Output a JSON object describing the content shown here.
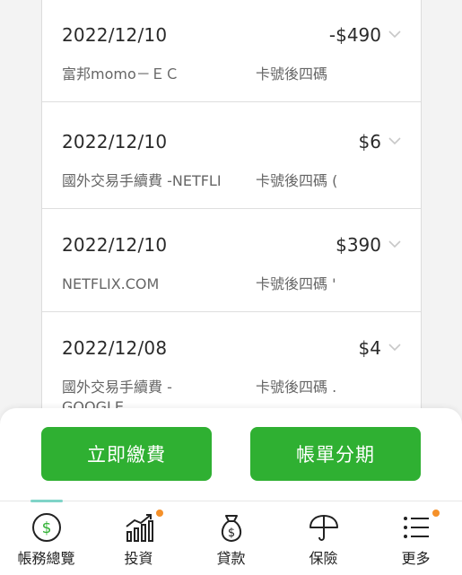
{
  "transactions": [
    {
      "date": "2022/12/10",
      "amount": "-$490",
      "merchant": "富邦momo－ＥＣ",
      "card": "卡號後四碼"
    },
    {
      "date": "2022/12/10",
      "amount": "$6",
      "merchant": "國外交易手續費 -NETFLI",
      "card": "卡號後四碼 ("
    },
    {
      "date": "2022/12/10",
      "amount": "$390",
      "merchant": "NETFLIX.COM",
      "card": "卡號後四碼 '"
    },
    {
      "date": "2022/12/08",
      "amount": "$4",
      "merchant": "國外交易手續費 -GOOGLE",
      "card": "卡號後四碼 ."
    }
  ],
  "actions": {
    "pay_label": "立即繳費",
    "installment_label": "帳單分期"
  },
  "tabs": [
    {
      "label": "帳務總覽",
      "icon": "dollar-circle-icon",
      "active": true,
      "badge": false
    },
    {
      "label": "投資",
      "icon": "bar-chart-icon",
      "active": false,
      "badge": true
    },
    {
      "label": "貸款",
      "icon": "money-bag-icon",
      "active": false,
      "badge": false
    },
    {
      "label": "保險",
      "icon": "umbrella-icon",
      "active": false,
      "badge": false
    },
    {
      "label": "更多",
      "icon": "menu-icon",
      "active": false,
      "badge": true
    }
  ],
  "colors": {
    "primary": "#2fb032",
    "active_indicator": "#7fd4c8",
    "badge": "#f5912a"
  }
}
